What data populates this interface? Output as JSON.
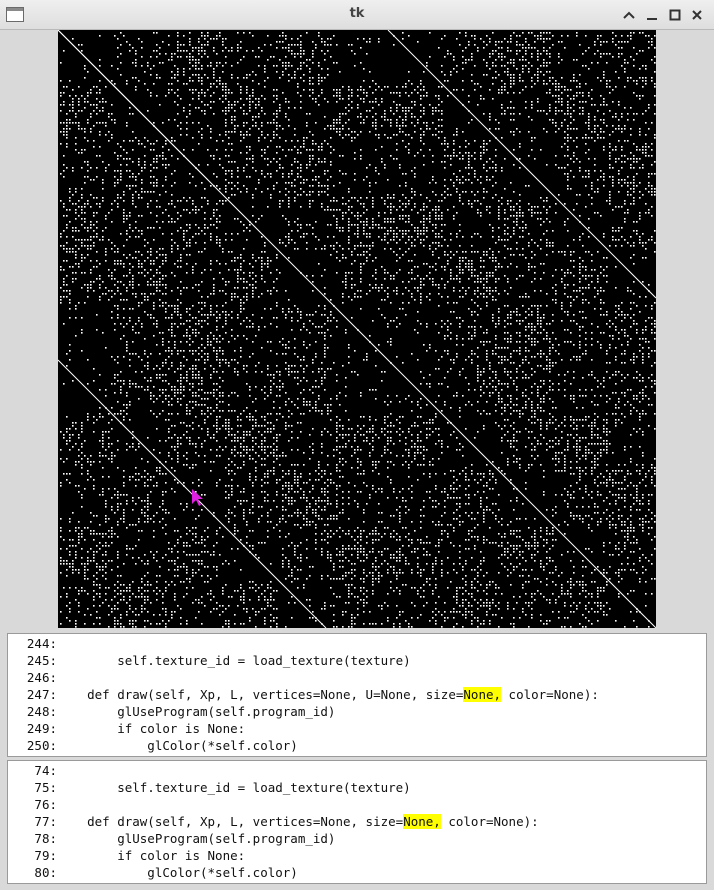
{
  "window": {
    "title": "tk",
    "buttons": [
      "chevron-up-icon",
      "minimize-icon",
      "maximize-icon",
      "close-icon"
    ]
  },
  "canvas": {
    "description_icon": "pixel-image",
    "cursor_icon": "magenta-arrow-cursor"
  },
  "pane1": {
    "lines": [
      {
        "num": "244:",
        "code": ""
      },
      {
        "num": "245:",
        "code": "        self.texture_id = load_texture(texture)"
      },
      {
        "num": "246:",
        "code": ""
      },
      {
        "num": "247:",
        "code": "    def draw(self, Xp, L, vertices=None, U=None, size=",
        "hl": "None,",
        "rest": " color=None):"
      },
      {
        "num": "248:",
        "code": "        glUseProgram(self.program_id)"
      },
      {
        "num": "249:",
        "code": "        if color is None:"
      },
      {
        "num": "250:",
        "code": "            glColor(*self.color)"
      }
    ]
  },
  "pane2": {
    "lines": [
      {
        "num": "74:",
        "code": ""
      },
      {
        "num": "75:",
        "code": "        self.texture_id = load_texture(texture)"
      },
      {
        "num": "76:",
        "code": ""
      },
      {
        "num": "77:",
        "code": "    def draw(self, Xp, L, vertices=None, size=",
        "hl": "None,",
        "rest": " color=None):"
      },
      {
        "num": "78:",
        "code": "        glUseProgram(self.program_id)"
      },
      {
        "num": "79:",
        "code": "        if color is None:"
      },
      {
        "num": "80:",
        "code": "            glColor(*self.color)"
      }
    ]
  }
}
